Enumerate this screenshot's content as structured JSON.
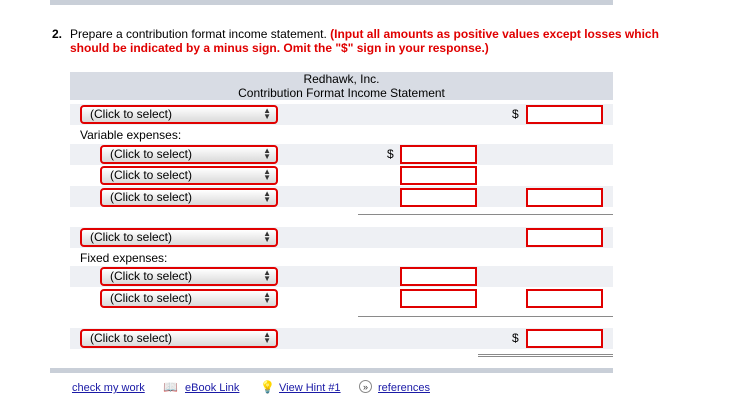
{
  "question": {
    "number": "2.",
    "text": "Prepare a contribution format income statement.",
    "instructions": "(Input all amounts as positive values except losses which should be indicated by a minus sign. Omit the \"$\" sign in your response.)"
  },
  "statement": {
    "company": "Redhawk, Inc.",
    "title": "Contribution Format Income Statement",
    "variable_expenses_label": "Variable expenses:",
    "fixed_expenses_label": "Fixed expenses:",
    "dollar": "$",
    "select_placeholder": "(Click to select)"
  },
  "footer": {
    "check_my_work": "check my work",
    "ebook": "eBook Link",
    "hint": "View Hint #1",
    "references": "references"
  },
  "colors": {
    "error_border": "#e00000",
    "link": "#1a1aa6",
    "header_bg": "#d8dce4"
  }
}
